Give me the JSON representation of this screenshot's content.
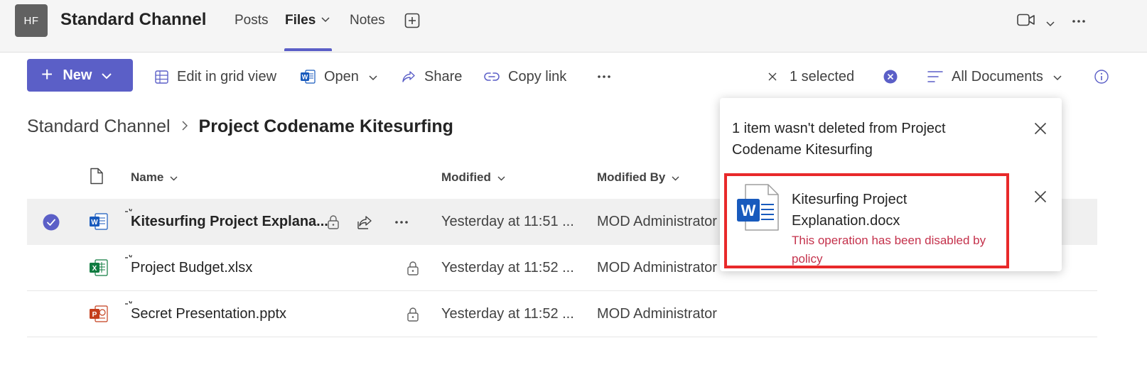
{
  "header": {
    "avatar": "HF",
    "channel_title": "Standard Channel",
    "tabs": [
      {
        "label": "Posts"
      },
      {
        "label": "Files"
      },
      {
        "label": "Notes"
      }
    ],
    "icons": [
      "add-tab-icon",
      "video-icon",
      "chevron-down-icon",
      "more-icon"
    ]
  },
  "toolbar": {
    "new_label": "New",
    "edit_grid_label": "Edit in grid view",
    "open_label": "Open",
    "share_label": "Share",
    "copy_link_label": "Copy link",
    "selected_label": "1 selected",
    "view_label": "All Documents"
  },
  "breadcrumb": {
    "parent": "Standard Channel",
    "current": "Project Codename Kitesurfing"
  },
  "table": {
    "columns": [
      "Name",
      "Modified",
      "Modified By"
    ],
    "rows": [
      {
        "name": "Kitesurfing Project Explana...",
        "type": "docx",
        "modified": "Yesterday at 11:51 ...",
        "modified_by": "MOD Administrator",
        "selected": true
      },
      {
        "name": "Project Budget.xlsx",
        "type": "xlsx",
        "modified": "Yesterday at 11:52 ...",
        "modified_by": "MOD Administrator",
        "selected": false
      },
      {
        "name": "Secret Presentation.pptx",
        "type": "pptx",
        "modified": "Yesterday at 11:52 ...",
        "modified_by": "MOD Administrator",
        "selected": false
      }
    ]
  },
  "popup": {
    "message": "1 item wasn't deleted from Project Codename Kitesurfing",
    "file_title": "Kitesurfing Project Explanation.docx",
    "error": "This operation has been disabled by policy"
  },
  "colors": {
    "accent": "#5b5fc7",
    "error_text": "#c4314b",
    "error_border": "#e8292a",
    "word": "#185abd",
    "excel": "#107c41",
    "powerpoint": "#c43e1c"
  }
}
